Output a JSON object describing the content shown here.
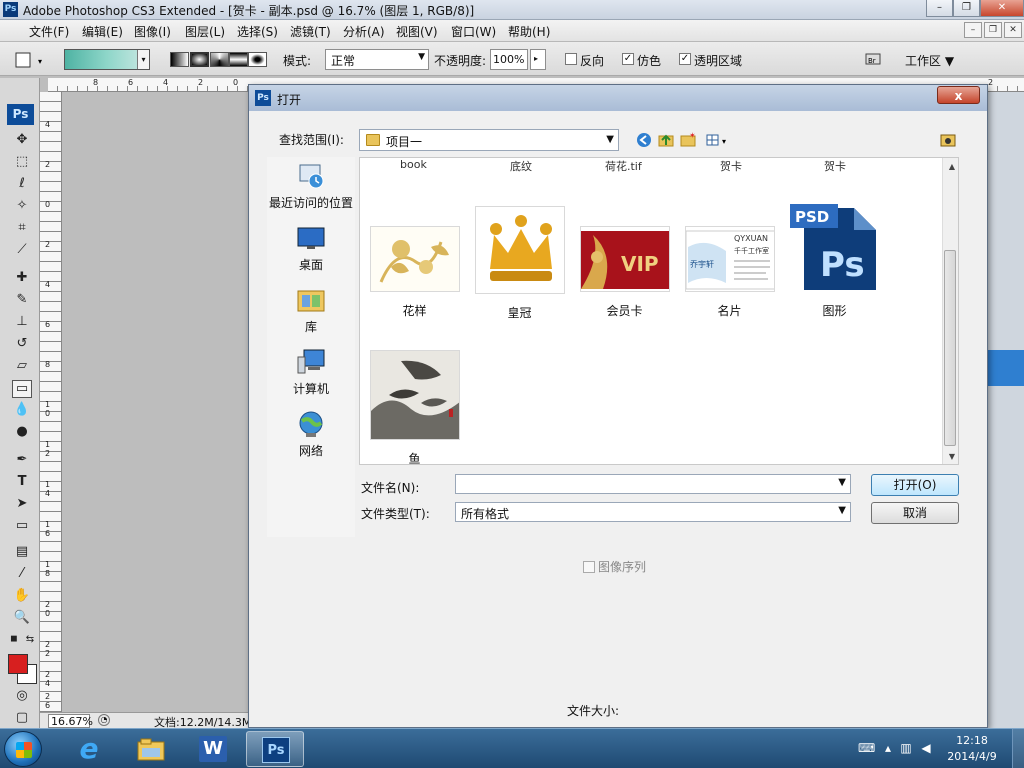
{
  "app": {
    "logo": "Ps",
    "title": "Adobe Photoshop CS3 Extended - [贺卡 - 副本.psd @ 16.7% (图层 1, RGB/8)]"
  },
  "menu": [
    "文件(F)",
    "编辑(E)",
    "图像(I)",
    "图层(L)",
    "选择(S)",
    "滤镜(T)",
    "分析(A)",
    "视图(V)",
    "窗口(W)",
    "帮助(H)"
  ],
  "options": {
    "mode_label": "模式:",
    "mode_value": "正常",
    "opacity_label": "不透明度:",
    "opacity_value": "100%",
    "reverse_label": "反向",
    "dither_label": "仿色",
    "transparency_label": "透明区域",
    "workspace_label": "工作区"
  },
  "toolbox": {
    "badge": "Ps"
  },
  "ruler": {
    "top": [
      "8",
      "6",
      "4",
      "2",
      "0",
      "2"
    ],
    "left": [
      "4",
      "2",
      "0",
      "2",
      "4",
      "6",
      "8",
      "1 0",
      "1 2",
      "1 4",
      "1 6",
      "1 8",
      "2 0",
      "2 2",
      "2 4",
      "2 6"
    ]
  },
  "status": {
    "zoom": "16.67%",
    "docinfo": "文档:12.2M/14.3M"
  },
  "dialog": {
    "icon": "Ps",
    "title": "打开",
    "close": "x",
    "lookin_label": "查找范围(I):",
    "lookin_value": "项目一",
    "places": [
      {
        "label": "最近访问的位置",
        "icon": "recent-places-icon"
      },
      {
        "label": "桌面",
        "icon": "desktop-icon"
      },
      {
        "label": "库",
        "icon": "libraries-icon"
      },
      {
        "label": "计算机",
        "icon": "computer-icon"
      },
      {
        "label": "网络",
        "icon": "network-icon"
      }
    ],
    "partial_labels": [
      "book",
      "底纹",
      "荷花.tif",
      "贺卡",
      "贺卡"
    ],
    "files": [
      {
        "label": "花样"
      },
      {
        "label": "皇冠"
      },
      {
        "label": "会员卡",
        "thumb_text": "VIP"
      },
      {
        "label": "名片",
        "thumb_text": "QYXUAN",
        "thumb_sub": "千千工作室",
        "thumb_left": "乔宇轩"
      },
      {
        "label": "图形",
        "thumb_text": "PSD",
        "thumb_sub": "Ps"
      },
      {
        "label": "鱼"
      }
    ],
    "filename_label": "文件名(N):",
    "filename_value": "",
    "filetype_label": "文件类型(T):",
    "filetype_value": "所有格式",
    "open_button": "打开(O)",
    "cancel_button": "取消",
    "sequence_label": "图像序列",
    "filesize_label": "文件大小:"
  },
  "taskbar": {
    "apps": [
      {
        "name": "ie",
        "glyph": "e"
      },
      {
        "name": "explorer",
        "glyph": ""
      },
      {
        "name": "word",
        "glyph": "W"
      },
      {
        "name": "photoshop",
        "glyph": "Ps"
      }
    ],
    "time": "12:18",
    "date": "2014/4/9"
  },
  "colors": {
    "foreground": "#d71f1f",
    "background": "#ffffff",
    "ps_blue": "#0d4c99"
  }
}
